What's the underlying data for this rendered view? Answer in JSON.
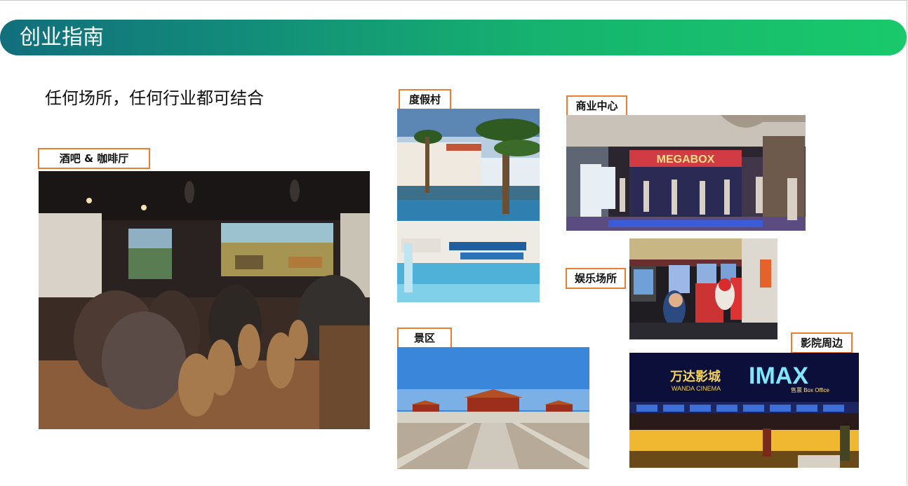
{
  "header": {
    "title": "创业指南"
  },
  "subtitle": "任何场所，任何行业都可结合",
  "labels": {
    "bar_cafe": "酒吧 & 咖啡厅",
    "resort": "度假村",
    "business_center": "商业中心",
    "entertainment": "娱乐场所",
    "scenic": "景区",
    "cinema": "影院周边"
  },
  "photo_text": {
    "megabox": "MEGABOX",
    "wanda": "万达影城",
    "wanda_en": "WANDA CINEMA",
    "imax": "IMAX",
    "box_office": "售票 Box Office"
  },
  "colors": {
    "banner_start": "#116f7c",
    "banner_end": "#19c96b",
    "label_border": "#ed7d31"
  }
}
